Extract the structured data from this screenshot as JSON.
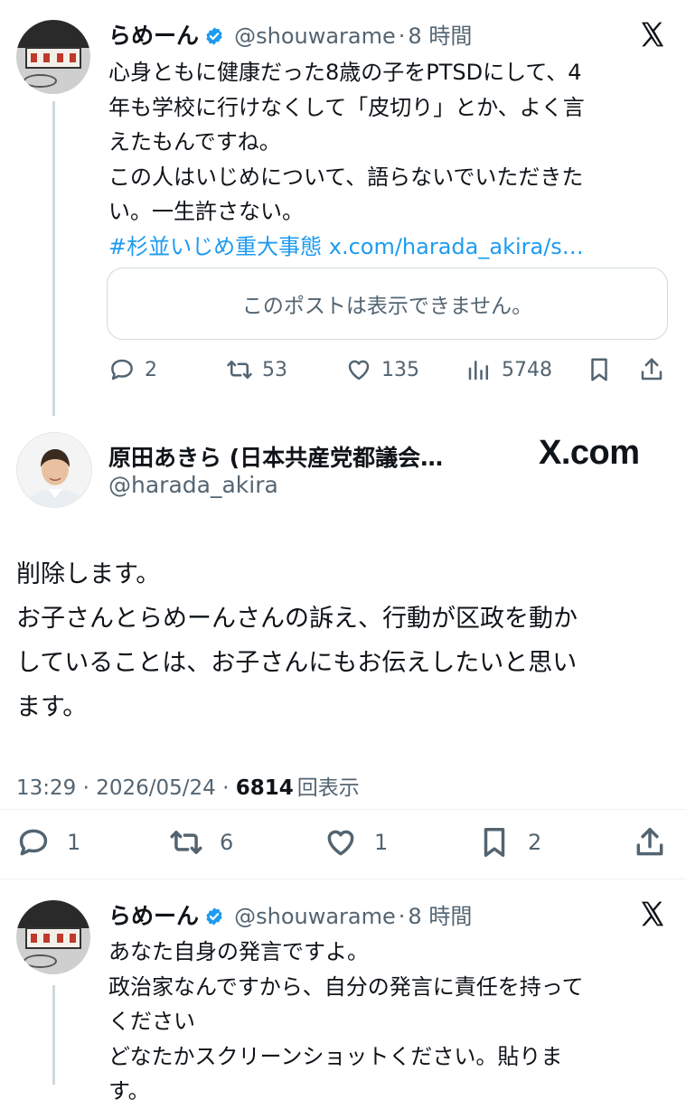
{
  "tweet1": {
    "name": "らめーん",
    "handle": "@shouwarame",
    "sep": "·",
    "time": "8 時間",
    "lines": [
      "心身ともに健康だった8歳の子をPTSDにして、4",
      "年も学校に行けなくして「皮切り」とか、よく言",
      "えたもんですね。",
      "この人はいじめについて、語らないでいただきた",
      "い。一生許さない。"
    ],
    "hashtag": "#杉並いじめ重大事態",
    "link": "x.com/harada_akira/s…",
    "quote_unavailable": "このポストは表示できません。",
    "replies": "2",
    "reposts": "53",
    "likes": "135",
    "views": "5748"
  },
  "main_tweet": {
    "name": "原田あきら (日本共産党都議会…",
    "handle": "@harada_akira",
    "brand": "X.com",
    "lines": [
      "削除します。",
      "お子さんとらめーんさんの訴え、行動が区政を動か",
      "していることは、お子さんにもお伝えしたいと思い",
      "ます。"
    ],
    "timestamp": "13:29 · 2026/05/24 · ",
    "view_count": "6814",
    "view_label": "回表示",
    "replies": "1",
    "reposts": "6",
    "likes": "1",
    "bookmarks": "2"
  },
  "tweet3": {
    "name": "らめーん",
    "handle": "@shouwarame",
    "sep": "·",
    "time": "8 時間",
    "lines": [
      "あなた自身の発言ですよ。",
      "政治家なんですから、自分の発言に責任を持って",
      "ください",
      "どなたかスクリーンショットください。貼りま",
      "す。"
    ]
  },
  "colors": {
    "link": "#1d9bf0",
    "secondary_text": "#536471",
    "verified_badge": "#1d9bf0"
  }
}
